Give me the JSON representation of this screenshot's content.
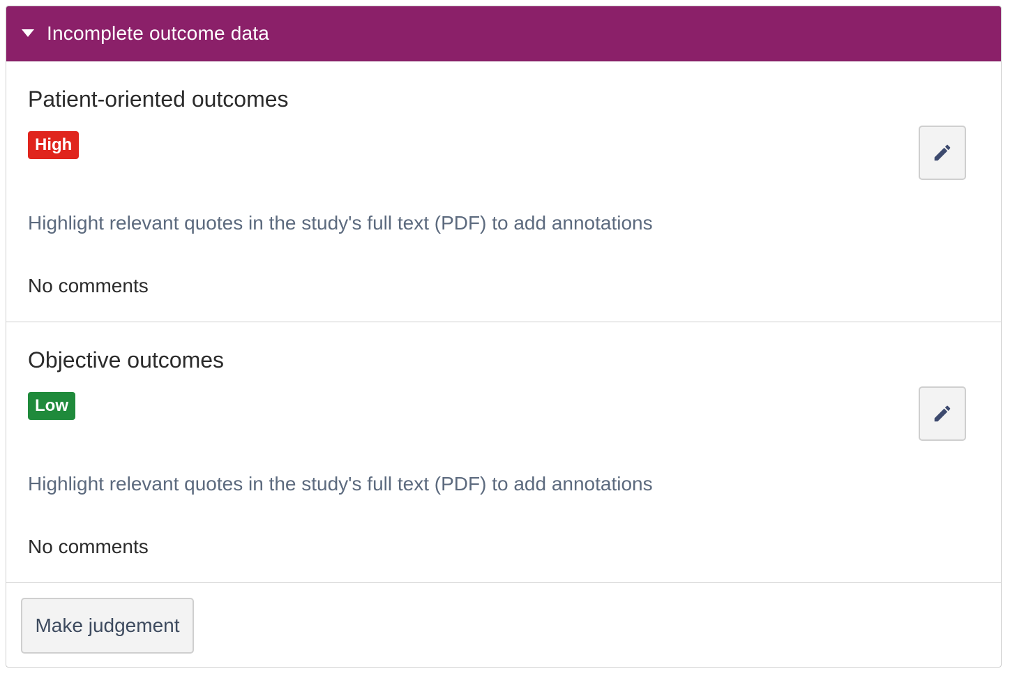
{
  "panel": {
    "title": "Incomplete outcome data"
  },
  "sections": [
    {
      "title": "Patient-oriented outcomes",
      "judgement": "High",
      "judgement_color": "#e0251d",
      "hint": "Highlight relevant quotes in the study's full text (PDF) to add annotations",
      "comments": "No comments",
      "edit_icon": "pencil-icon"
    },
    {
      "title": "Objective outcomes",
      "judgement": "Low",
      "judgement_color": "#1f8a3b",
      "hint": "Highlight relevant quotes in the study's full text (PDF) to add annotations",
      "comments": "No comments",
      "edit_icon": "pencil-icon"
    }
  ],
  "footer": {
    "make_judgement_label": "Make judgement"
  },
  "colors": {
    "header_bg": "#8b2069",
    "header_text": "#ffffff",
    "hint_text": "#5c6a7e",
    "icon": "#3d4a6e"
  }
}
